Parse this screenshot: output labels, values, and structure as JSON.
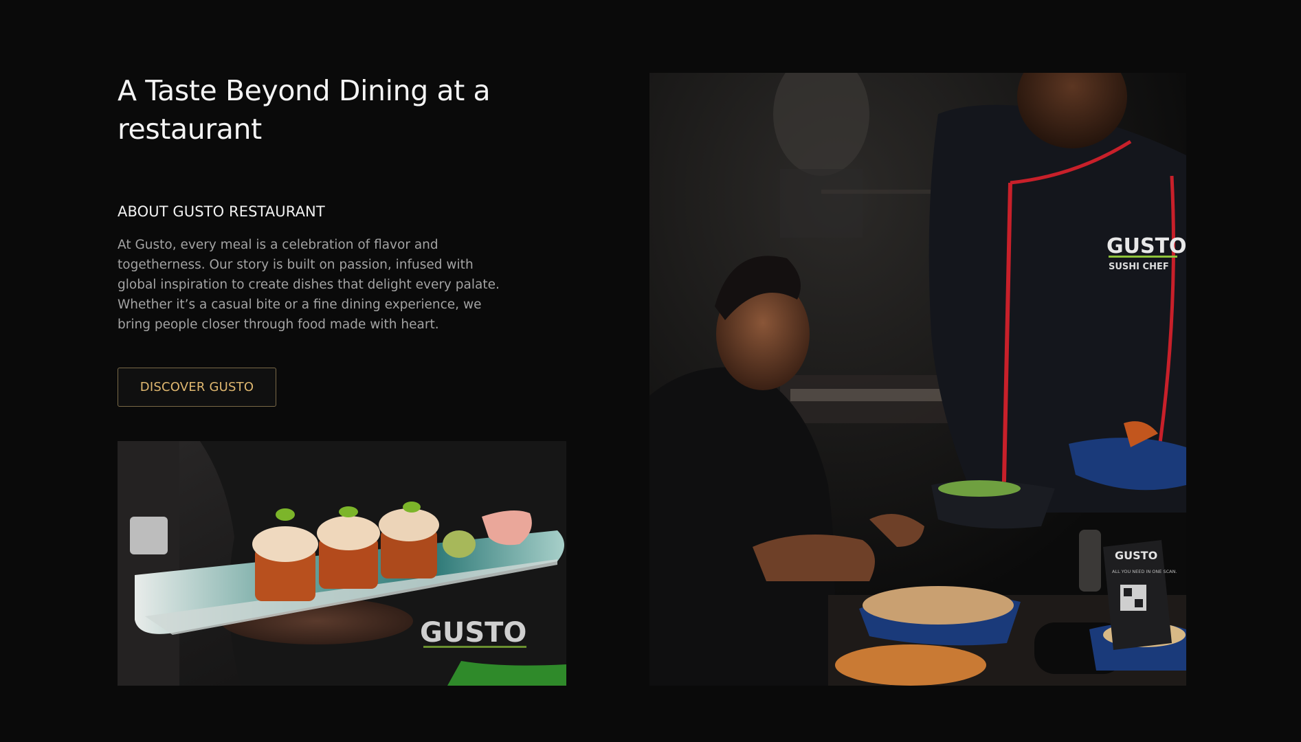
{
  "hero": {
    "title": "A Taste Beyond Dining at a restaurant"
  },
  "about": {
    "heading": "ABOUT GUSTO RESTAURANT",
    "body": "At Gusto, every meal is a celebration of flavor and togetherness. Our story is built on passion, infused with global inspiration to create dishes that delight every palate. Whether it’s a casual bite or a fine dining experience, we bring people closer through food made with heart.",
    "cta_label": "DISCOVER GUSTO"
  },
  "images": {
    "sushi": {
      "icon": "sushi-platter-photo",
      "apron_logo": "GUSTO"
    },
    "dining": {
      "icon": "restaurant-dining-photo",
      "chef_logo": "GUSTO",
      "chef_role": "SUSHI CHEF",
      "table_card_logo": "GUSTO",
      "table_card_text": "ALL YOU NEED IN ONE SCAN."
    }
  },
  "colors": {
    "background": "#0a0a0a",
    "accent": "#e0b870",
    "chef_trim": "#c8202a",
    "logo_green": "#8fc43a"
  }
}
